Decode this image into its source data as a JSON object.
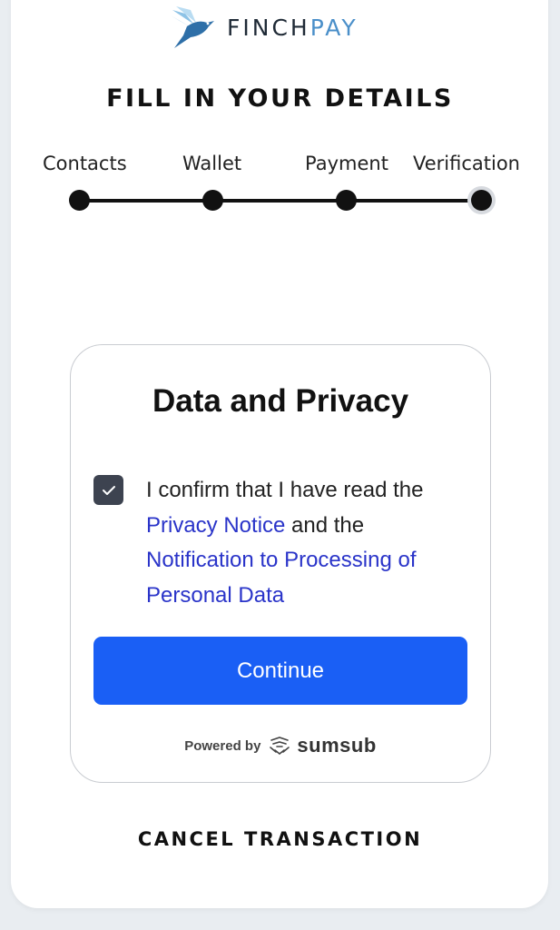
{
  "header": {
    "logo_text_primary": "FINCH",
    "logo_text_accent": "PAY",
    "title": "FILL IN YOUR DETAILS"
  },
  "steps": [
    {
      "label": "Contacts",
      "state": "complete"
    },
    {
      "label": "Wallet",
      "state": "complete"
    },
    {
      "label": "Payment",
      "state": "complete"
    },
    {
      "label": "Verification",
      "state": "current"
    }
  ],
  "privacy": {
    "title": "Data and Privacy",
    "checkbox_checked": true,
    "consent_prefix": "I confirm that I have read the ",
    "privacy_notice_link": "Privacy Notice",
    "consent_middle": " and the ",
    "processing_link": "Notification to Processing of Personal Data",
    "continue_label": "Continue",
    "powered_by_label": "Powered by",
    "powered_by_brand": "sumsub"
  },
  "footer": {
    "cancel_label": "CANCEL TRANSACTION"
  },
  "colors": {
    "primary_button": "#1a5ff5",
    "link": "#2a34c9",
    "logo_accent": "#4a8fc9",
    "background": "#e9edf1"
  }
}
